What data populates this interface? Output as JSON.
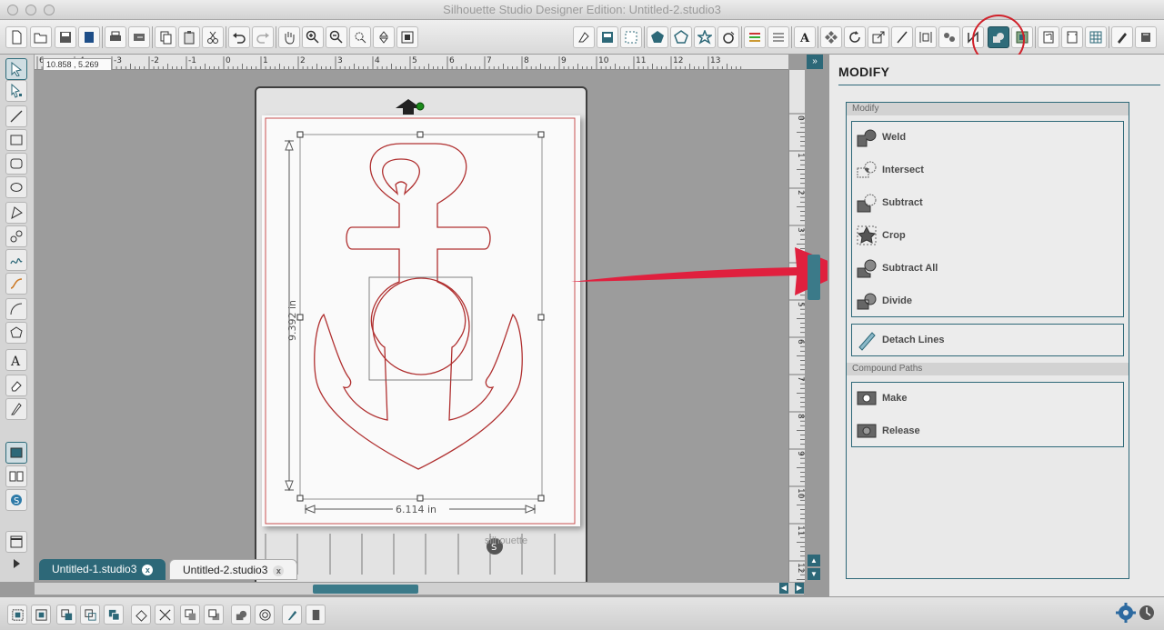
{
  "window": {
    "title": "Silhouette Studio Designer Edition: Untitled-2.studio3"
  },
  "status": {
    "coordinates": "10.858 , 5.269"
  },
  "rulers": {
    "horizontal": [
      "6",
      "-4",
      "-3",
      "-2",
      "-1",
      "0",
      "1",
      "2",
      "3",
      "4",
      "5",
      "6",
      "7",
      "8",
      "9",
      "10",
      "11",
      "12",
      "13"
    ],
    "vertical": [
      "0",
      "1",
      "2",
      "3",
      "4",
      "5",
      "6",
      "7",
      "8",
      "9",
      "10",
      "11",
      "12"
    ]
  },
  "canvas": {
    "width_label": "6.114 in",
    "height_label": "9.392 in",
    "brand": "silhouette"
  },
  "tabs": [
    {
      "label": "Untitled-1.studio3",
      "close": "x"
    },
    {
      "label": "Untitled-2.studio3",
      "close": "x"
    }
  ],
  "panel": {
    "title": "MODIFY",
    "section_modify": "Modify",
    "items": [
      "Weld",
      "Intersect",
      "Subtract",
      "Crop",
      "Subtract All",
      "Divide"
    ],
    "detach": "Detach Lines",
    "section_compound": "Compound Paths",
    "compound_items": [
      "Make",
      "Release"
    ]
  },
  "collapse_glyph": "»",
  "colors": {
    "accent": "#2d6878",
    "cut_line": "#b03030",
    "arrow": "#e0203e",
    "highlight_circle": "#d0212a"
  }
}
